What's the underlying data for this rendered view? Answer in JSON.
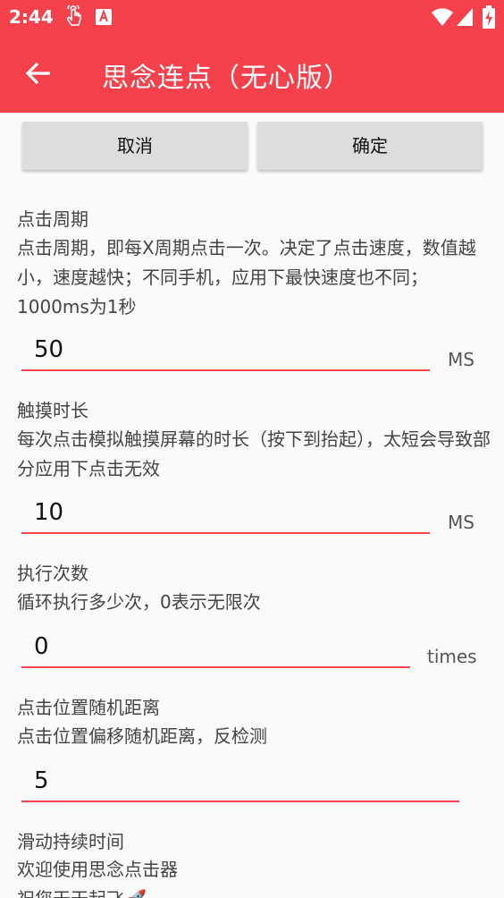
{
  "status_bar": {
    "time": "2:44",
    "icons": [
      "touch-icon",
      "app-notification-icon",
      "wifi-icon",
      "signal-icon",
      "battery-charging-icon"
    ]
  },
  "toolbar": {
    "title": "思念连点（无心版）",
    "accent_color": "#f4414c"
  },
  "buttons": {
    "cancel": "取消",
    "confirm": "确定"
  },
  "fields": [
    {
      "label": "点击周期",
      "description": "点击周期，即每X周期点击一次。决定了点击速度，数值越小，速度越快；不同手机，应用下最快速度也不同；1000ms为1秒",
      "value": "50",
      "unit": "MS"
    },
    {
      "label": "触摸时长",
      "description": "每次点击模拟触摸屏幕的时长（按下到抬起），太短会导致部分应用下点击无效",
      "value": "10",
      "unit": "MS"
    },
    {
      "label": "执行次数",
      "description": "循环执行多少次，0表示无限次",
      "value": "0",
      "unit": "times"
    },
    {
      "label": "点击位置随机距离",
      "description": "点击位置偏移随机距离，反检测",
      "value": "5",
      "unit": ""
    },
    {
      "label": "滑动持续时间",
      "description": "欢迎使用思念点击器",
      "description2": "祝您天天起飞🚀"
    }
  ]
}
